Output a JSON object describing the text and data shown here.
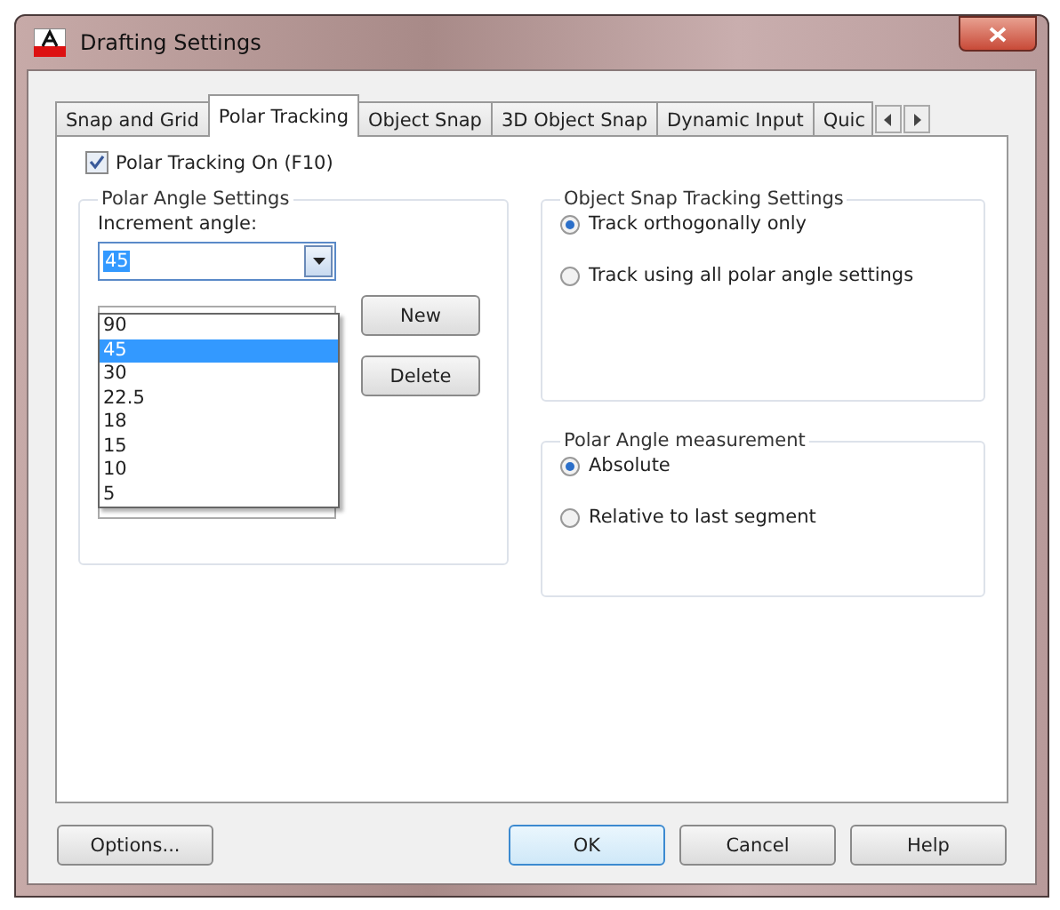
{
  "window": {
    "title": "Drafting Settings"
  },
  "tabs": [
    {
      "label": "Snap and Grid",
      "selected": false
    },
    {
      "label": "Polar Tracking",
      "selected": true
    },
    {
      "label": "Object Snap",
      "selected": false
    },
    {
      "label": "3D Object Snap",
      "selected": false
    },
    {
      "label": "Dynamic Input",
      "selected": false
    },
    {
      "label": "Quic",
      "selected": false
    }
  ],
  "polar_tracking_on": {
    "label": "Polar Tracking On (F10)",
    "checked": true
  },
  "polar_angle_settings": {
    "title": "Polar Angle Settings",
    "increment_label": "Increment angle:",
    "increment_value": "45",
    "dropdown_items": [
      {
        "label": "90",
        "selected": false
      },
      {
        "label": "45",
        "selected": true
      },
      {
        "label": "30",
        "selected": false
      },
      {
        "label": "22.5",
        "selected": false
      },
      {
        "label": "18",
        "selected": false
      },
      {
        "label": "15",
        "selected": false
      },
      {
        "label": "10",
        "selected": false
      },
      {
        "label": "5",
        "selected": false
      }
    ],
    "buttons": [
      "New",
      "Delete"
    ]
  },
  "object_snap_tracking": {
    "title": "Object Snap Tracking Settings",
    "options": [
      {
        "label": "Track orthogonally only",
        "selected": true
      },
      {
        "label": "Track using all polar angle settings",
        "selected": false
      }
    ]
  },
  "polar_angle_measurement": {
    "title": "Polar Angle measurement",
    "options": [
      {
        "label": "Absolute",
        "selected": true
      },
      {
        "label": "Relative to last segment",
        "selected": false
      }
    ]
  },
  "footer_buttons": [
    {
      "label": "Options...",
      "default": false
    },
    {
      "label": "OK",
      "default": true
    },
    {
      "label": "Cancel",
      "default": false
    },
    {
      "label": "Help",
      "default": false
    }
  ]
}
